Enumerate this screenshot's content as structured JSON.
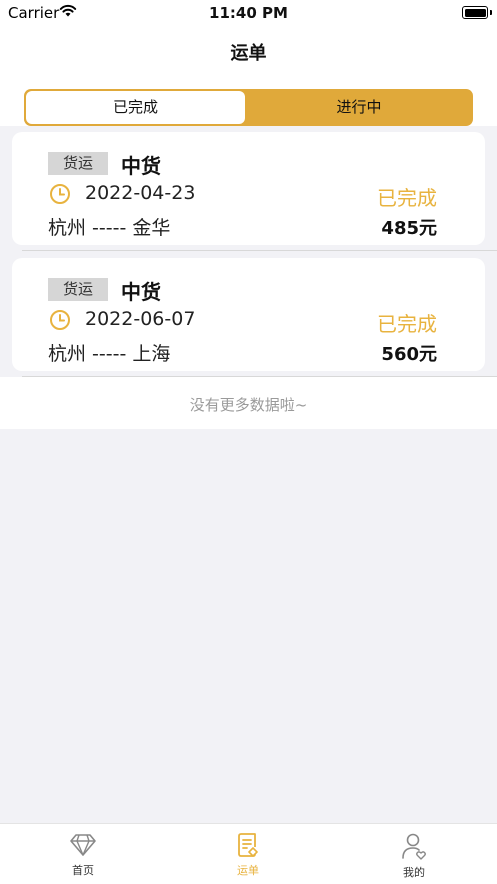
{
  "status_bar": {
    "carrier": "Carrier",
    "time": "11:40 PM"
  },
  "nav": {
    "title": "运单"
  },
  "segment": {
    "done_label": "已完成",
    "ongoing_label": "进行中",
    "selected": "已完成"
  },
  "orders": [
    {
      "tag": "货运",
      "cargo": "中货",
      "date": "2022-04-23",
      "status": "已完成",
      "route": "杭州 ----- 金华",
      "price": "485元"
    },
    {
      "tag": "货运",
      "cargo": "中货",
      "date": "2022-06-07",
      "status": "已完成",
      "route": "杭州 ----- 上海",
      "price": "560元"
    }
  ],
  "list_footer": "没有更多数据啦~",
  "tabbar": {
    "items": [
      {
        "label": "首页",
        "icon": "diamond-icon"
      },
      {
        "label": "运单",
        "icon": "waybill-icon"
      },
      {
        "label": "我的",
        "icon": "profile-icon"
      }
    ],
    "active": "运单"
  },
  "colors": {
    "accent": "#e0a93a",
    "status_text": "#e8b33f",
    "background": "#f2f2f6"
  }
}
